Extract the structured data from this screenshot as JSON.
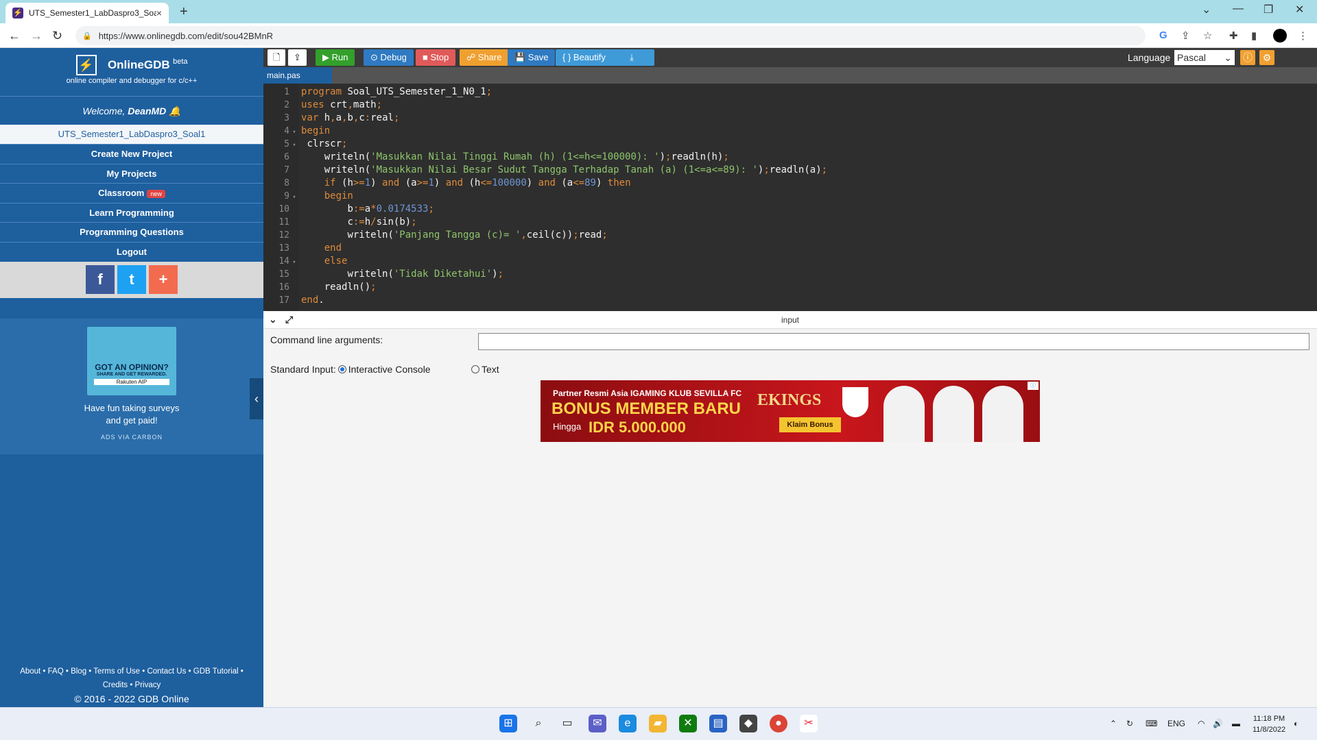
{
  "browser": {
    "tab_title": "UTS_Semester1_LabDaspro3_Soa",
    "tab_close": "×",
    "new_tab": "+",
    "url": "https://www.onlinegdb.com/edit/sou42BMnR",
    "back": "←",
    "forward": "→",
    "reload": "↻",
    "lock": "🔒",
    "win_min": "—",
    "win_max": "❐",
    "win_close": "✕",
    "win_chevron": "⌄"
  },
  "sidebar": {
    "brand_name": "OnlineGDB",
    "brand_beta": "beta",
    "brand_sub": "online compiler and debugger for c/c++",
    "welcome_prefix": "Welcome, ",
    "welcome_user": "DeanMD",
    "project_name": "UTS_Semester1_LabDaspro3_Soal1",
    "menu": [
      {
        "label": "Create New Project"
      },
      {
        "label": "My Projects"
      },
      {
        "label": "Classroom",
        "badge": "new"
      },
      {
        "label": "Learn Programming"
      },
      {
        "label": "Programming Questions"
      },
      {
        "label": "Logout"
      }
    ],
    "social": {
      "facebook": "f",
      "twitter": "t",
      "plus": "+"
    },
    "ad": {
      "headline": "GOT AN OPINION?",
      "sub": "SHARE AND GET REWARDED.",
      "brand": "Rakuten AIP",
      "text1": "Have fun taking surveys",
      "text2": "and get paid!",
      "via": "ADS VIA CARBON"
    },
    "footer": {
      "line1": "About • FAQ • Blog • Terms of Use • Contact Us • GDB Tutorial •",
      "line2": "Credits • Privacy",
      "copyright": "© 2016 - 2022 GDB Online"
    },
    "collapse": "‹"
  },
  "toolbar": {
    "run": "▶ Run",
    "debug": "⊙ Debug",
    "stop": "■ Stop",
    "share": "☍ Share",
    "save": "💾 Save",
    "beautify": "{ } Beautify",
    "download": "⤓",
    "language_label": "Language",
    "language_value": "Pascal",
    "colors": {
      "run": "#33a02c",
      "debug": "#2f7ac2",
      "stop": "#e05a5a",
      "share": "#f0a030",
      "save": "#2f7ac2",
      "beautify": "#3f9ad8",
      "download": "#3f9ad8"
    }
  },
  "editor": {
    "file_tab": "main.pas",
    "lines": [
      {
        "n": "1",
        "fold": "",
        "code": [
          [
            "kw",
            "program "
          ],
          [
            "id",
            "Soal_UTS_Semester_1_N0_1"
          ],
          [
            "op",
            ";"
          ]
        ]
      },
      {
        "n": "2",
        "fold": "",
        "code": [
          [
            "kw",
            "uses "
          ],
          [
            "id",
            "crt"
          ],
          [
            "op",
            ","
          ],
          [
            "id",
            "math"
          ],
          [
            "op",
            ";"
          ]
        ]
      },
      {
        "n": "3",
        "fold": "",
        "code": [
          [
            "kw",
            "var "
          ],
          [
            "id",
            "h"
          ],
          [
            "op",
            ","
          ],
          [
            "id",
            "a"
          ],
          [
            "op",
            ","
          ],
          [
            "id",
            "b"
          ],
          [
            "op",
            ","
          ],
          [
            "id",
            "c"
          ],
          [
            "op",
            ":"
          ],
          [
            "id",
            "real"
          ],
          [
            "op",
            ";"
          ]
        ]
      },
      {
        "n": "4",
        "fold": "▾",
        "code": [
          [
            "kw",
            "begin"
          ]
        ]
      },
      {
        "n": "5",
        "fold": "▾",
        "code": [
          [
            "pl",
            " "
          ],
          [
            "id",
            "clrscr"
          ],
          [
            "op",
            ";"
          ]
        ]
      },
      {
        "n": "6",
        "fold": "",
        "code": [
          [
            "pl",
            "    "
          ],
          [
            "id",
            "writeln("
          ],
          [
            "str",
            "'Masukkan Nilai Tinggi Rumah (h) (1<=h<=100000): '"
          ],
          [
            "id",
            ")"
          ],
          [
            "op",
            ";"
          ],
          [
            "id",
            "readln(h)"
          ],
          [
            "op",
            ";"
          ]
        ]
      },
      {
        "n": "7",
        "fold": "",
        "code": [
          [
            "pl",
            "    "
          ],
          [
            "id",
            "writeln("
          ],
          [
            "str",
            "'Masukkan Nilai Besar Sudut Tangga Terhadap Tanah (a) (1<=a<=89): '"
          ],
          [
            "id",
            ")"
          ],
          [
            "op",
            ";"
          ],
          [
            "id",
            "readln(a)"
          ],
          [
            "op",
            ";"
          ]
        ]
      },
      {
        "n": "8",
        "fold": "",
        "code": [
          [
            "pl",
            "    "
          ],
          [
            "kw",
            "if "
          ],
          [
            "id",
            "(h"
          ],
          [
            "op",
            ">="
          ],
          [
            "num",
            "1"
          ],
          [
            "id",
            ") "
          ],
          [
            "kw",
            "and "
          ],
          [
            "id",
            "(a"
          ],
          [
            "op",
            ">="
          ],
          [
            "num",
            "1"
          ],
          [
            "id",
            ") "
          ],
          [
            "kw",
            "and "
          ],
          [
            "id",
            "(h"
          ],
          [
            "op",
            "<="
          ],
          [
            "num",
            "100000"
          ],
          [
            "id",
            ") "
          ],
          [
            "kw",
            "and "
          ],
          [
            "id",
            "(a"
          ],
          [
            "op",
            "<="
          ],
          [
            "num",
            "89"
          ],
          [
            "id",
            ") "
          ],
          [
            "kw",
            "then"
          ]
        ]
      },
      {
        "n": "9",
        "fold": "▾",
        "code": [
          [
            "pl",
            "    "
          ],
          [
            "kw",
            "begin"
          ]
        ]
      },
      {
        "n": "10",
        "fold": "",
        "code": [
          [
            "pl",
            "        "
          ],
          [
            "id",
            "b"
          ],
          [
            "op",
            ":="
          ],
          [
            "id",
            "a"
          ],
          [
            "op",
            "*"
          ],
          [
            "num",
            "0.0174533"
          ],
          [
            "op",
            ";"
          ]
        ]
      },
      {
        "n": "11",
        "fold": "",
        "code": [
          [
            "pl",
            "        "
          ],
          [
            "id",
            "c"
          ],
          [
            "op",
            ":="
          ],
          [
            "id",
            "h"
          ],
          [
            "op",
            "/"
          ],
          [
            "id",
            "sin(b)"
          ],
          [
            "op",
            ";"
          ]
        ]
      },
      {
        "n": "12",
        "fold": "",
        "code": [
          [
            "pl",
            "        "
          ],
          [
            "id",
            "writeln("
          ],
          [
            "str",
            "'Panjang Tangga (c)= '"
          ],
          [
            "op",
            ","
          ],
          [
            "id",
            "ceil(c))"
          ],
          [
            "op",
            ";"
          ],
          [
            "id",
            "read"
          ],
          [
            "op",
            ";"
          ]
        ]
      },
      {
        "n": "13",
        "fold": "",
        "code": [
          [
            "pl",
            "    "
          ],
          [
            "kw",
            "end"
          ]
        ]
      },
      {
        "n": "14",
        "fold": "▾",
        "code": [
          [
            "pl",
            "    "
          ],
          [
            "kw",
            "else"
          ]
        ]
      },
      {
        "n": "15",
        "fold": "",
        "code": [
          [
            "pl",
            "        "
          ],
          [
            "id",
            "writeln("
          ],
          [
            "str",
            "'Tidak Diketahui'"
          ],
          [
            "id",
            ")"
          ],
          [
            "op",
            ";"
          ]
        ]
      },
      {
        "n": "16",
        "fold": "",
        "code": [
          [
            "pl",
            "    "
          ],
          [
            "id",
            "readln()"
          ],
          [
            "op",
            ";"
          ]
        ]
      },
      {
        "n": "17",
        "fold": "",
        "code": [
          [
            "kw",
            "end"
          ],
          [
            "id",
            "."
          ]
        ]
      }
    ]
  },
  "input_panel": {
    "title": "input",
    "collapse_icon": "⌄",
    "expand_icon": "⤢",
    "cmd_label": "Command line arguments:",
    "stdin_label": "Standard Input:",
    "opt_interactive": "Interactive Console",
    "opt_text": "Text"
  },
  "banner": {
    "line1": "Partner Resmi Asia IGAMING KLUB SEVILLA FC",
    "line2": "BONUS MEMBER BARU",
    "line3": "Hingga",
    "line4": "IDR 5.000.000",
    "brand": "EKINGS",
    "button": "Klaim Bonus",
    "adx": "ⓘ"
  },
  "taskbar": {
    "lang": "ENG",
    "time": "11:18 PM",
    "date": "11/8/2022"
  }
}
